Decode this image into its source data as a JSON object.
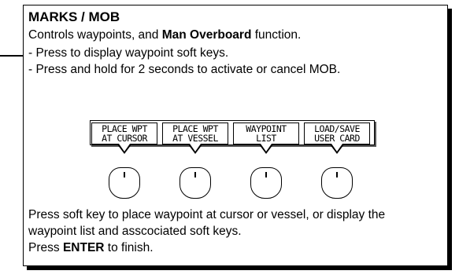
{
  "title": "MARKS / MOB",
  "desc": {
    "prefix": "Controls waypoints, and ",
    "bold": "Man Overboard",
    "suffix": " function."
  },
  "bullets": [
    "- Press to display waypoint soft keys.",
    "- Press and hold for 2 seconds to activate or cancel MOB."
  ],
  "softkeys": [
    {
      "line1": "PLACE WPT",
      "line2": "AT CURSOR"
    },
    {
      "line1": "PLACE WPT",
      "line2": "AT VESSEL"
    },
    {
      "line1": "WAYPOINT",
      "line2": "LIST"
    },
    {
      "line1": "LOAD/SAVE",
      "line2": "USER CARD"
    }
  ],
  "footer": {
    "line1": "Press soft key to place waypoint at cursor or vessel, or display the",
    "line2": "waypoint list and asscociated soft keys.",
    "line3_prefix": "Press ",
    "line3_bold": "ENTER",
    "line3_suffix": " to finish."
  }
}
